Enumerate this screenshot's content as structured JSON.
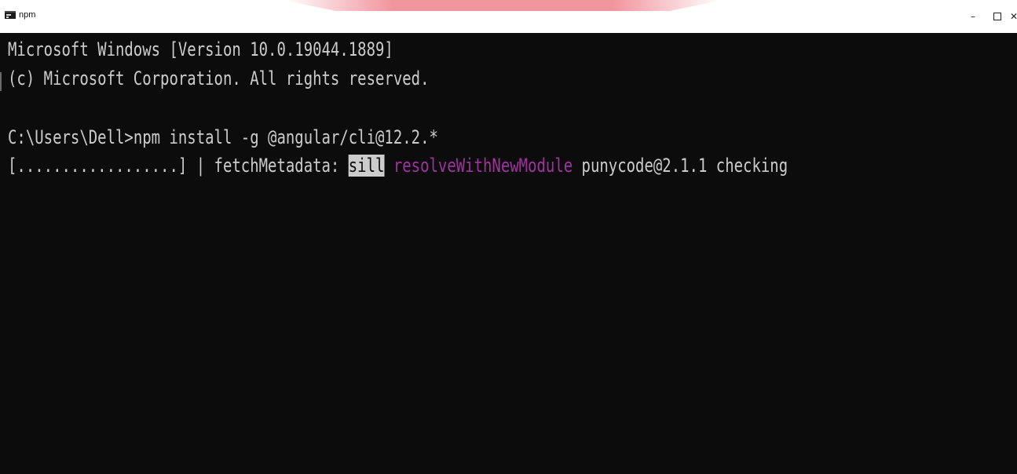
{
  "window": {
    "title": "npm",
    "icon": "console-icon",
    "controls": {
      "minimize": "minimize-icon",
      "maximize": "maximize-icon",
      "close": "close-icon"
    }
  },
  "console": {
    "background": "#0c0c0c",
    "text_color": "#cccccc",
    "highlight_color": "#a032a0",
    "line1": "Microsoft Windows [Version 10.0.19044.1889]",
    "line2": "(c) Microsoft Corporation. All rights reserved.",
    "prompt": "C:\\Users\\Dell>",
    "command": "npm install -g @angular/cli@12.2.*",
    "progress": {
      "bar": "[..................] | fetchMetadata: ",
      "level": "sill",
      "action": "resolveWithNewModule",
      "message": " punycode@2.1.1 checking"
    }
  }
}
